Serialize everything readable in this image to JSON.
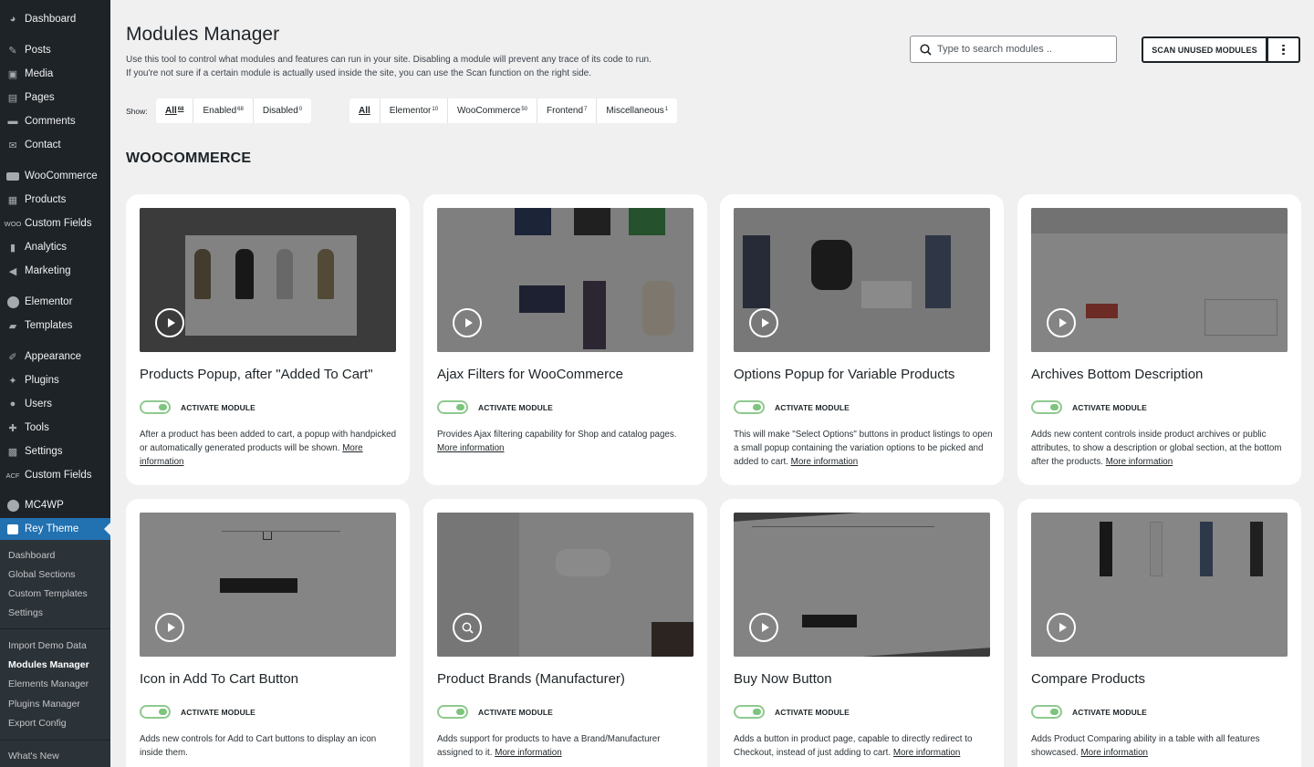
{
  "sidebar": {
    "items": [
      {
        "label": "Dashboard",
        "icon": "dashboard-icon"
      },
      {
        "label": "Posts",
        "icon": "pin-icon"
      },
      {
        "label": "Media",
        "icon": "media-icon"
      },
      {
        "label": "Pages",
        "icon": "pages-icon"
      },
      {
        "label": "Comments",
        "icon": "comments-icon"
      },
      {
        "label": "Contact",
        "icon": "mail-icon"
      },
      {
        "label": "WooCommerce",
        "icon": "woo-icon"
      },
      {
        "label": "Products",
        "icon": "archive-icon"
      },
      {
        "label": "Custom Fields",
        "icon": "woo-text-icon",
        "icon_text": "WOO"
      },
      {
        "label": "Analytics",
        "icon": "bar-chart-icon"
      },
      {
        "label": "Marketing",
        "icon": "megaphone-icon"
      },
      {
        "label": "Elementor",
        "icon": "elementor-icon"
      },
      {
        "label": "Templates",
        "icon": "folder-icon"
      },
      {
        "label": "Appearance",
        "icon": "brush-icon"
      },
      {
        "label": "Plugins",
        "icon": "plugin-icon"
      },
      {
        "label": "Users",
        "icon": "user-icon"
      },
      {
        "label": "Tools",
        "icon": "wrench-icon"
      },
      {
        "label": "Settings",
        "icon": "settings-icon"
      },
      {
        "label": "Custom Fields",
        "icon": "acf-text-icon",
        "icon_text": "ACF"
      },
      {
        "label": "MC4WP",
        "icon": "mc4wp-icon"
      },
      {
        "label": "Rey Theme",
        "icon": "rey-icon"
      }
    ],
    "submenu": [
      "Dashboard",
      "Global Sections",
      "Custom Templates",
      "Settings",
      "Import Demo Data",
      "Modules Manager",
      "Elements Manager",
      "Plugins Manager",
      "Export Config",
      "What's New"
    ]
  },
  "header": {
    "title": "Modules Manager",
    "desc_line1": "Use this tool to control what modules and features can run in your site. Disabling a module will prevent any trace of its code to run.",
    "desc_line2": "If you're not sure if a certain module is actually used inside the site, you can use the Scan function on the right side.",
    "search_placeholder": "Type to search modules ..",
    "scan_label": "SCAN UNUSED MODULES"
  },
  "filters": {
    "show_label": "Show:",
    "status": [
      {
        "label": "All",
        "count": "68",
        "active": true
      },
      {
        "label": "Enabled",
        "count": "68",
        "active": false
      },
      {
        "label": "Disabled",
        "count": "0",
        "active": false
      }
    ],
    "categories": [
      {
        "label": "All",
        "count": "",
        "active": true
      },
      {
        "label": "Elementor",
        "count": "10",
        "active": false
      },
      {
        "label": "WooCommerce",
        "count": "50",
        "active": false
      },
      {
        "label": "Frontend",
        "count": "7",
        "active": false
      },
      {
        "label": "Miscellaneous",
        "count": "1",
        "active": false
      }
    ]
  },
  "section_title": "WOOCOMMERCE",
  "activate_label": "ACTIVATE MODULE",
  "more_info": "More information",
  "modules": [
    {
      "title": "Products Popup, after \"Added To Cart\"",
      "desc": "After a product has been added to cart, a popup with handpicked or automatically generated products will be shown.",
      "has_more": true,
      "media": "video",
      "enabled": true
    },
    {
      "title": "Ajax Filters for WooCommerce",
      "desc": "Provides Ajax filtering capability for Shop and catalog pages.",
      "has_more": true,
      "media": "video",
      "enabled": true
    },
    {
      "title": "Options Popup for Variable Products",
      "desc": "This will make \"Select Options\" buttons in product listings to open a small popup containing the variation options to be picked and added to cart.",
      "has_more": true,
      "media": "video",
      "enabled": true
    },
    {
      "title": "Archives Bottom Description",
      "desc": "Adds new content controls inside product archives or public attributes, to show a description or global section, at the bottom after the products.",
      "has_more": true,
      "media": "video",
      "enabled": true
    },
    {
      "title": "Icon in Add To Cart Button",
      "desc": "Adds new controls for Add to Cart buttons to display an icon inside them.",
      "has_more": false,
      "media": "video",
      "enabled": true
    },
    {
      "title": "Product Brands (Manufacturer)",
      "desc": "Adds support for products to have a Brand/Manufacturer assigned to it.",
      "has_more": true,
      "media": "image",
      "enabled": true
    },
    {
      "title": "Buy Now Button",
      "desc": "Adds a button in product page, capable to directly redirect to Checkout, instead of just adding to cart.",
      "has_more": true,
      "media": "video",
      "enabled": true
    },
    {
      "title": "Compare Products",
      "desc": "Adds Product Comparing ability in a table with all features showcased.",
      "has_more": true,
      "media": "video",
      "enabled": true
    }
  ]
}
